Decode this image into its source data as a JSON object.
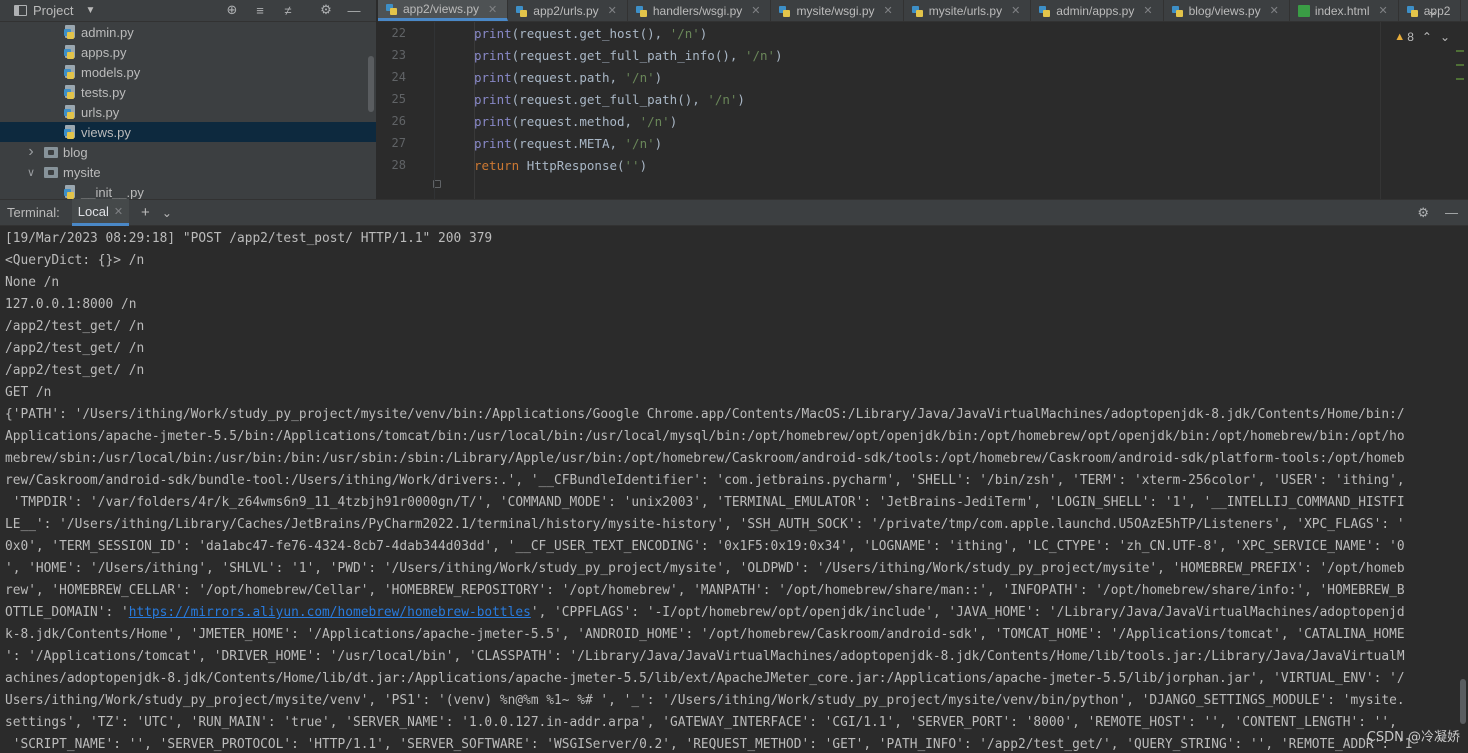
{
  "project_panel": {
    "title": "Project",
    "tree": [
      {
        "label": "admin.py",
        "type": "py",
        "indent": 3
      },
      {
        "label": "apps.py",
        "type": "py",
        "indent": 3
      },
      {
        "label": "models.py",
        "type": "py",
        "indent": 3
      },
      {
        "label": "tests.py",
        "type": "py",
        "indent": 3
      },
      {
        "label": "urls.py",
        "type": "py",
        "indent": 3
      },
      {
        "label": "views.py",
        "type": "py",
        "indent": 3,
        "selected": true
      },
      {
        "label": "blog",
        "type": "folder",
        "indent": 1,
        "expanded": false
      },
      {
        "label": "mysite",
        "type": "folder",
        "indent": 1,
        "expanded": true
      },
      {
        "label": "__init__.py",
        "type": "py",
        "indent": 3
      }
    ]
  },
  "editor": {
    "tabs": [
      {
        "label": "app2/views.py",
        "icon": "py",
        "active": true
      },
      {
        "label": "app2/urls.py",
        "icon": "py"
      },
      {
        "label": "handlers/wsgi.py",
        "icon": "py"
      },
      {
        "label": "mysite/wsgi.py",
        "icon": "py"
      },
      {
        "label": "mysite/urls.py",
        "icon": "py"
      },
      {
        "label": "admin/apps.py",
        "icon": "py"
      },
      {
        "label": "blog/views.py",
        "icon": "py"
      },
      {
        "label": "index.html",
        "icon": "html"
      },
      {
        "label": "app2",
        "icon": "py"
      }
    ],
    "warning_count": "8",
    "lines": [
      {
        "n": "22",
        "tokens": [
          [
            "fn",
            "print"
          ],
          [
            "id",
            "(request.get_host(), "
          ],
          [
            "str",
            "'/n'"
          ],
          [
            "id",
            ")"
          ]
        ]
      },
      {
        "n": "23",
        "tokens": [
          [
            "fn",
            "print"
          ],
          [
            "id",
            "(request.get_full_path_info(), "
          ],
          [
            "str",
            "'/n'"
          ],
          [
            "id",
            ")"
          ]
        ]
      },
      {
        "n": "24",
        "tokens": [
          [
            "fn",
            "print"
          ],
          [
            "id",
            "(request.path, "
          ],
          [
            "str",
            "'/n'"
          ],
          [
            "id",
            ")"
          ]
        ]
      },
      {
        "n": "25",
        "tokens": [
          [
            "fn",
            "print"
          ],
          [
            "id",
            "(request.get_full_path(), "
          ],
          [
            "str",
            "'/n'"
          ],
          [
            "id",
            ")"
          ]
        ]
      },
      {
        "n": "26",
        "tokens": [
          [
            "fn",
            "print"
          ],
          [
            "id",
            "(request.method, "
          ],
          [
            "str",
            "'/n'"
          ],
          [
            "id",
            ")"
          ]
        ]
      },
      {
        "n": "27",
        "tokens": [
          [
            "fn",
            "print"
          ],
          [
            "id",
            "(request.META, "
          ],
          [
            "str",
            "'/n'"
          ],
          [
            "id",
            ")"
          ]
        ]
      },
      {
        "n": "28",
        "tokens": [
          [
            "kw",
            "return "
          ],
          [
            "id",
            "HttpResponse("
          ],
          [
            "str",
            "''"
          ],
          [
            "id",
            ")"
          ]
        ]
      }
    ]
  },
  "terminal": {
    "label": "Terminal:",
    "tab": "Local",
    "lines": [
      "[19/Mar/2023 08:29:18] \"POST /app2/test_post/ HTTP/1.1\" 200 379",
      "<QueryDict: {}> /n",
      "None /n",
      "127.0.0.1:8000 /n",
      "/app2/test_get/ /n",
      "/app2/test_get/ /n",
      "/app2/test_get/ /n",
      "GET /n",
      "{'PATH': '/Users/ithing/Work/study_py_project/mysite/venv/bin:/Applications/Google Chrome.app/Contents/MacOS:/Library/Java/JavaVirtualMachines/adoptopenjdk-8.jdk/Contents/Home/bin:/",
      "Applications/apache-jmeter-5.5/bin:/Applications/tomcat/bin:/usr/local/bin:/usr/local/mysql/bin:/opt/homebrew/opt/openjdk/bin:/opt/homebrew/opt/openjdk/bin:/opt/homebrew/bin:/opt/ho",
      "mebrew/sbin:/usr/local/bin:/usr/bin:/bin:/usr/sbin:/sbin:/Library/Apple/usr/bin:/opt/homebrew/Caskroom/android-sdk/tools:/opt/homebrew/Caskroom/android-sdk/platform-tools:/opt/homeb",
      "rew/Caskroom/android-sdk/bundle-tool:/Users/ithing/Work/drivers:.', '__CFBundleIdentifier': 'com.jetbrains.pycharm', 'SHELL': '/bin/zsh', 'TERM': 'xterm-256color', 'USER': 'ithing',",
      " 'TMPDIR': '/var/folders/4r/k_z64wms6n9_11_4tzbjh91r0000gn/T/', 'COMMAND_MODE': 'unix2003', 'TERMINAL_EMULATOR': 'JetBrains-JediTerm', 'LOGIN_SHELL': '1', '__INTELLIJ_COMMAND_HISTFI",
      "LE__': '/Users/ithing/Library/Caches/JetBrains/PyCharm2022.1/terminal/history/mysite-history', 'SSH_AUTH_SOCK': '/private/tmp/com.apple.launchd.U5OAzE5hTP/Listeners', 'XPC_FLAGS': '",
      "0x0', 'TERM_SESSION_ID': 'da1abc47-fe76-4324-8cb7-4dab344d03dd', '__CF_USER_TEXT_ENCODING': '0x1F5:0x19:0x34', 'LOGNAME': 'ithing', 'LC_CTYPE': 'zh_CN.UTF-8', 'XPC_SERVICE_NAME': '0",
      "', 'HOME': '/Users/ithing', 'SHLVL': '1', 'PWD': '/Users/ithing/Work/study_py_project/mysite', 'OLDPWD': '/Users/ithing/Work/study_py_project/mysite', 'HOMEBREW_PREFIX': '/opt/homeb",
      "rew', 'HOMEBREW_CELLAR': '/opt/homebrew/Cellar', 'HOMEBREW_REPOSITORY': '/opt/homebrew', 'MANPATH': '/opt/homebrew/share/man::', 'INFOPATH': '/opt/homebrew/share/info:', 'HOMEBREW_B",
      "__LINK_LINE__",
      "k-8.jdk/Contents/Home', 'JMETER_HOME': '/Applications/apache-jmeter-5.5', 'ANDROID_HOME': '/opt/homebrew/Caskroom/android-sdk', 'TOMCAT_HOME': '/Applications/tomcat', 'CATALINA_HOME",
      "': '/Applications/tomcat', 'DRIVER_HOME': '/usr/local/bin', 'CLASSPATH': '/Library/Java/JavaVirtualMachines/adoptopenjdk-8.jdk/Contents/Home/lib/tools.jar:/Library/Java/JavaVirtualM",
      "achines/adoptopenjdk-8.jdk/Contents/Home/lib/dt.jar:/Applications/apache-jmeter-5.5/lib/ext/ApacheJMeter_core.jar:/Applications/apache-jmeter-5.5/lib/jorphan.jar', 'VIRTUAL_ENV': '/",
      "Users/ithing/Work/study_py_project/mysite/venv', 'PS1': '(venv) %n@%m %1~ %# ', '_': '/Users/ithing/Work/study_py_project/mysite/venv/bin/python', 'DJANGO_SETTINGS_MODULE': 'mysite.",
      "settings', 'TZ': 'UTC', 'RUN_MAIN': 'true', 'SERVER_NAME': '1.0.0.127.in-addr.arpa', 'GATEWAY_INTERFACE': 'CGI/1.1', 'SERVER_PORT': '8000', 'REMOTE_HOST': '', 'CONTENT_LENGTH': '',",
      " 'SCRIPT_NAME': '', 'SERVER_PROTOCOL': 'HTTP/1.1', 'SERVER_SOFTWARE': 'WSGIServer/0.2', 'REQUEST_METHOD': 'GET', 'PATH_INFO': '/app2/test_get/', 'QUERY_STRING': '', 'REMOTE_ADDR': '1"
    ],
    "link_line": {
      "before": "OTTLE_DOMAIN': '",
      "link": "https://mirrors.aliyun.com/homebrew/homebrew-bottles",
      "after": "', 'CPPFLAGS': '-I/opt/homebrew/opt/openjdk/include', 'JAVA_HOME': '/Library/Java/JavaVirtualMachines/adoptopenjd"
    }
  },
  "watermark": "CSDN @冷凝娇"
}
